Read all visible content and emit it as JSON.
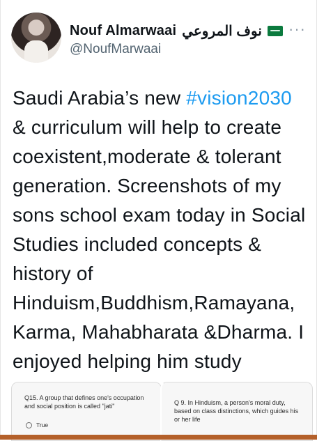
{
  "tweet": {
    "author_name": "Nouf Almarwaai",
    "author_name_arabic": "نوف المروعي",
    "handle": "@NoufMarwaai",
    "more_label": "···",
    "text_before_hashtag": "Saudi Arabia’s new ",
    "hashtag": "#vision2030",
    "text_after_hashtag": " & curriculum will help to create coexistent,moderate & tolerant generation. Screenshots of my sons school exam today in Social Studies included concepts & history of Hinduism,Buddhism,Ramayana, Karma, Mahabharata &Dharma. I enjoyed helping him study"
  },
  "media": {
    "cards": [
      {
        "question": "Q15. A group that defines one's occupation and social position is called \"jati\"",
        "option": "True"
      },
      {
        "question": "Q 9. In Hinduism, a person's moral duty, based on class distinctions, which guides his or her life",
        "option": ""
      }
    ]
  },
  "colors": {
    "accent": "#1d9bf0",
    "secondary_text": "#536471",
    "flag_green": "#0b7a3e"
  }
}
